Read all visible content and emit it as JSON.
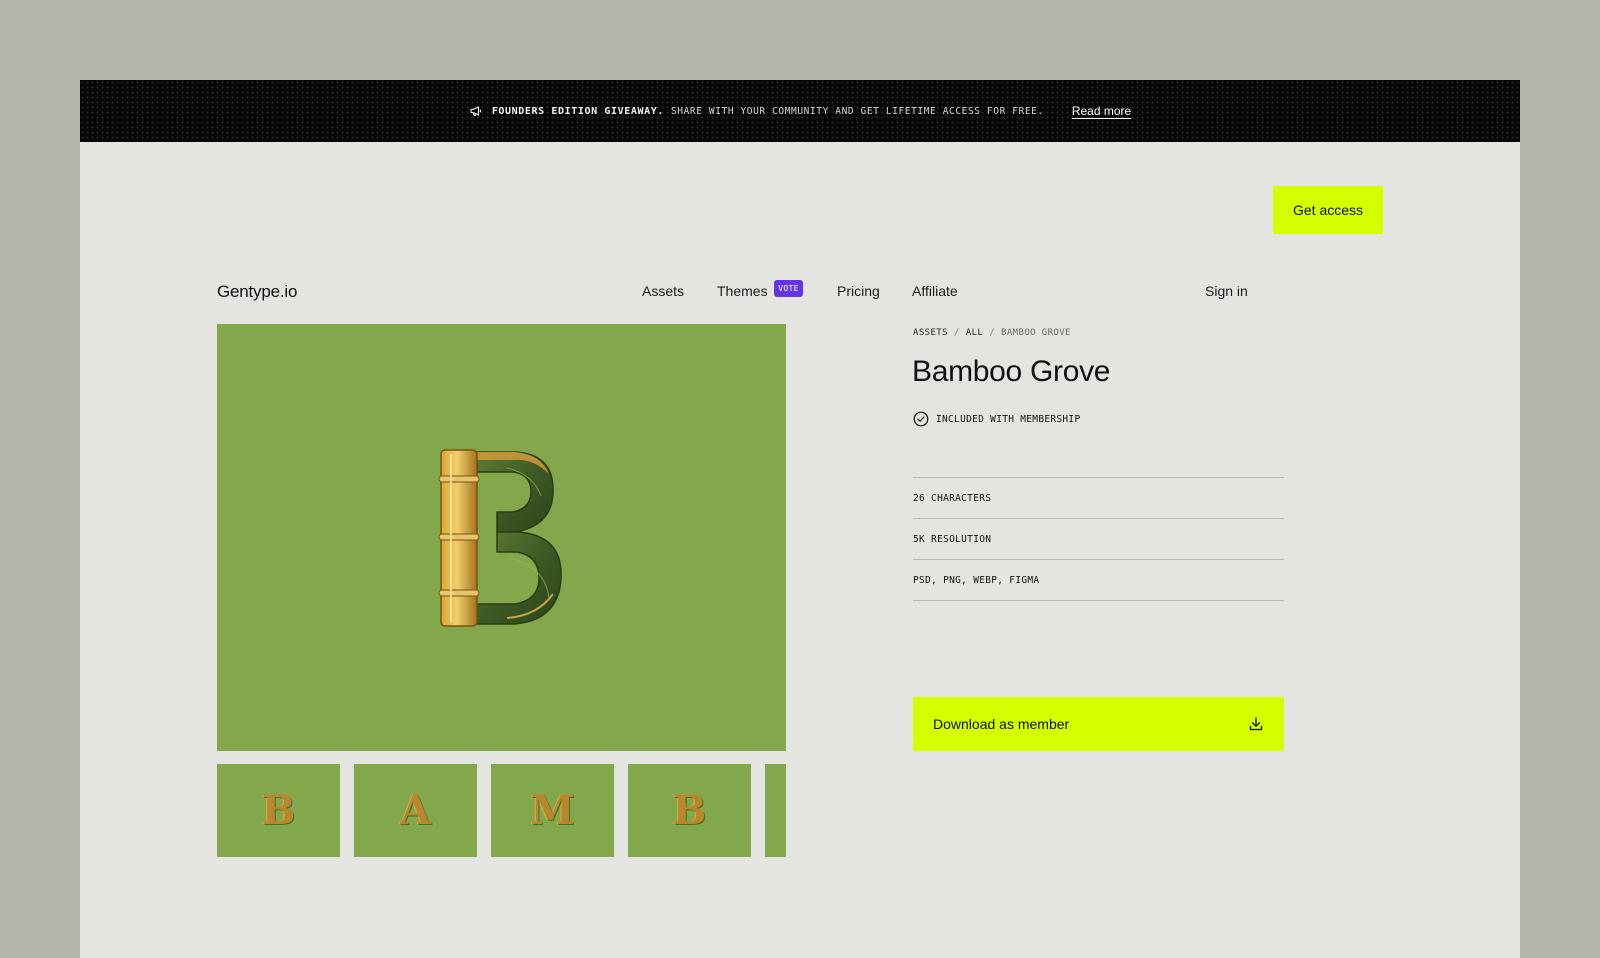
{
  "announcement": {
    "strong": "FOUNDERS EDITION GIVEAWAY.",
    "text": "SHARE WITH YOUR COMMUNITY AND GET LIFETIME ACCESS FOR FREE.",
    "link": "Read more",
    "icon": "megaphone-icon"
  },
  "header": {
    "logo": "Gentype.io",
    "nav": [
      {
        "label": "Assets"
      },
      {
        "label": "Themes",
        "badge": "VOTE"
      },
      {
        "label": "Pricing"
      },
      {
        "label": "Affiliate"
      }
    ],
    "sign_in": "Sign in",
    "cta": "Get access"
  },
  "colors": {
    "accent": "#d4ff00",
    "badge": "#6435e6",
    "preview_bg": "#83a84c",
    "page_bg": "#e4e5e0",
    "announcement_bg": "#070707"
  },
  "preview": {
    "main_letter": "B",
    "thumbnails": [
      "B",
      "A",
      "M",
      "B",
      ""
    ]
  },
  "product": {
    "breadcrumb": [
      "ASSETS",
      "ALL",
      "BAMBOO GROVE"
    ],
    "title": "Bamboo Grove",
    "included": "INCLUDED WITH MEMBERSHIP",
    "specs": [
      "26 CHARACTERS",
      "5K RESOLUTION",
      "PSD, PNG, WEBP, FIGMA"
    ],
    "download": "Download as member"
  }
}
